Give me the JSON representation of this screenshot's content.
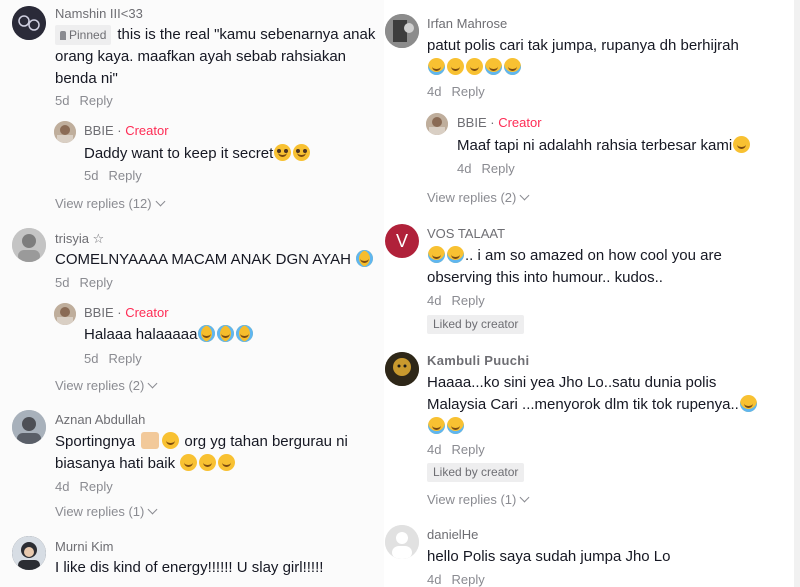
{
  "left": {
    "c1": {
      "name": "Namshin III<33",
      "pinned": "Pinned",
      "text1": "this is the real \"kamu sebenarnya anak",
      "text2": "orang kaya. maafkan ayah sebab rahsiakan",
      "text3": "benda ni\"",
      "time": "5d",
      "reply": "Reply"
    },
    "c1r": {
      "name": "BBIE",
      "creator": "Creator",
      "text": "Daddy want to keep it secret",
      "time": "5d",
      "reply": "Reply"
    },
    "c1v": "View replies (12)",
    "c2": {
      "name": "trisyia ☆",
      "text": "COMELNYAAAA MACAM ANAK DGN AYAH",
      "time": "5d",
      "reply": "Reply"
    },
    "c2r": {
      "name": "BBIE",
      "creator": "Creator",
      "text": "Halaaa halaaaaa",
      "time": "5d",
      "reply": "Reply"
    },
    "c2v": "View replies (2)",
    "c3": {
      "name": "Aznan Abdullah",
      "text_a": "Sportingnya",
      "text_b": "org yg tahan bergurau ni",
      "text2": "biasanya hati baik",
      "time": "4d",
      "reply": "Reply"
    },
    "c3v": "View replies (1)",
    "c4": {
      "name": "Murni Kim",
      "text": "I like dis kind of energy!!!!!! U slay girl!!!!!"
    }
  },
  "right": {
    "c1": {
      "name": "Irfan Mahrose",
      "text": "patut polis cari tak jumpa, rupanya dh berhijrah",
      "time": "4d",
      "reply": "Reply"
    },
    "c1r": {
      "name": "BBIE",
      "creator": "Creator",
      "text": "Maaf tapi ni adalahh rahsia terbesar kami",
      "time": "4d",
      "reply": "Reply"
    },
    "c1v": "View replies (2)",
    "c2": {
      "name": "VOS TALAAT",
      "avatar_letter": "V",
      "text1": ".. i am so amazed on how cool you are",
      "text2": "observing this into humour.. kudos..",
      "time": "4d",
      "reply": "Reply",
      "badge": "Liked by creator"
    },
    "c3": {
      "name": "Kambuli Puuchi",
      "text1": "Haaaa...ko sini yea Jho Lo..satu dunia polis",
      "text2": "Malaysia Cari ...menyorok dlm tik tok rupenya..",
      "time": "4d",
      "reply": "Reply",
      "badge": "Liked by creator"
    },
    "c3v": "View replies (1)",
    "c4": {
      "name": "danielHe",
      "text": "hello Polis saya sudah jumpa Jho Lo",
      "time": "4d",
      "reply": "Reply"
    }
  },
  "colors": {
    "creator": "#fe2c55",
    "muted": "#8a8b91",
    "text": "#161823",
    "vos_avatar": "#b0213a"
  }
}
